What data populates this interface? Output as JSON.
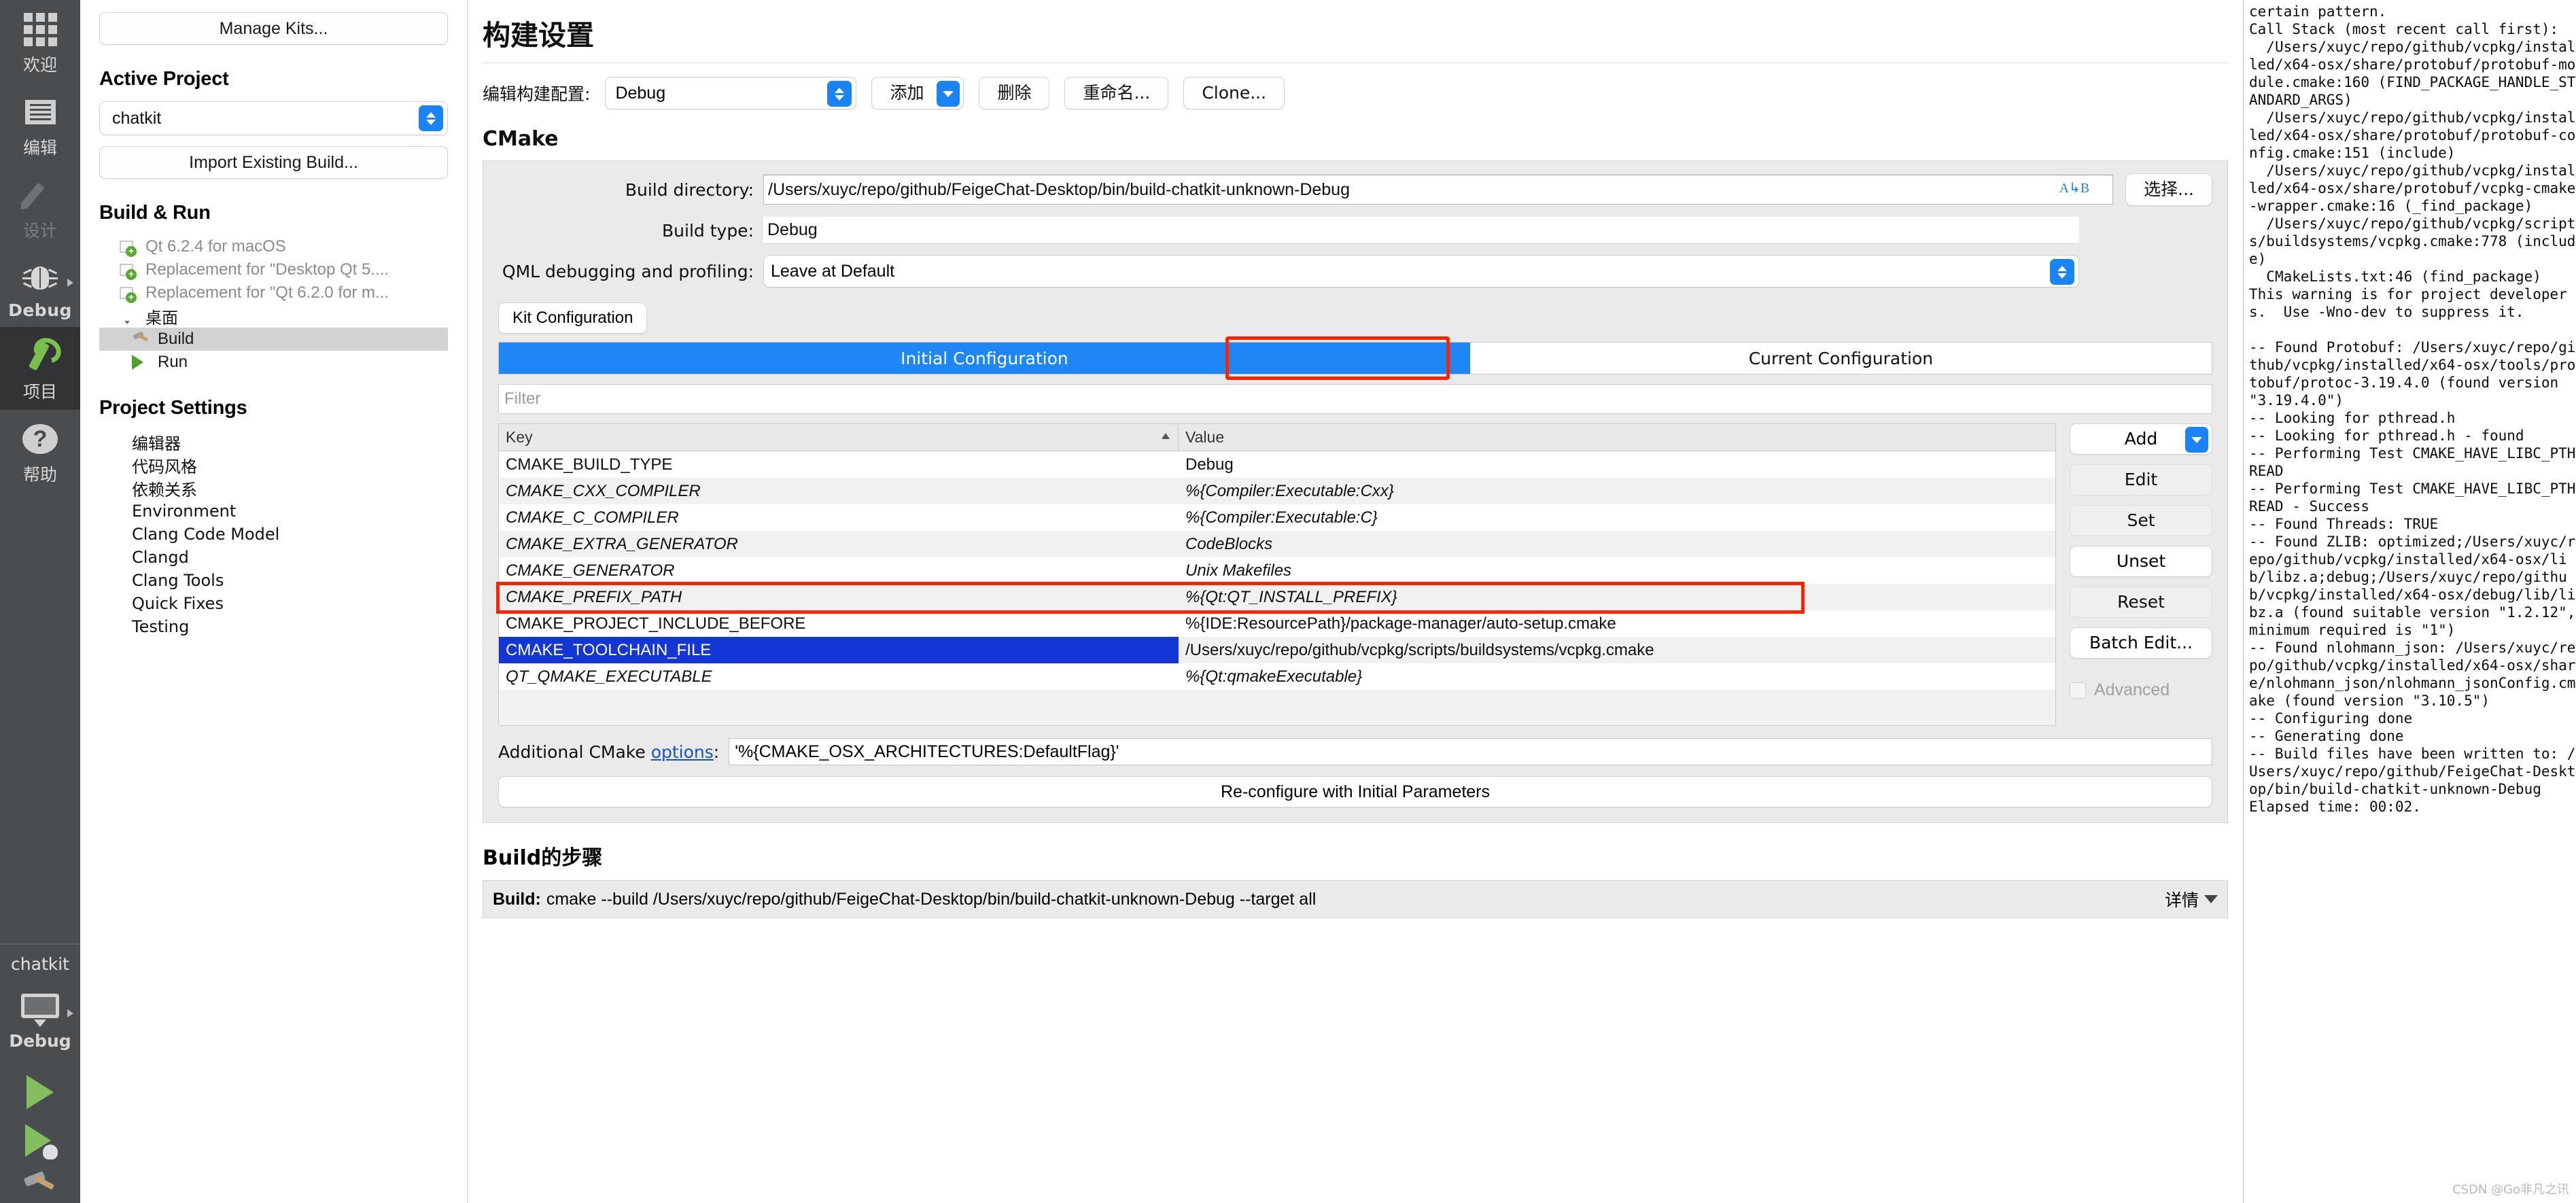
{
  "modebar": {
    "items": [
      {
        "label": "欢迎",
        "icon": "grid-icon",
        "state": "normal"
      },
      {
        "label": "编辑",
        "icon": "document-icon",
        "state": "normal"
      },
      {
        "label": "设计",
        "icon": "pencil-icon",
        "state": "disabled"
      },
      {
        "label": "Debug",
        "icon": "bug-icon",
        "state": "normal"
      },
      {
        "label": "项目",
        "icon": "wrench-icon",
        "state": "active"
      },
      {
        "label": "帮助",
        "icon": "question-icon",
        "state": "normal"
      }
    ],
    "bottom": {
      "kit_name": "chatkit",
      "target_label": "Debug",
      "run_icon": "run-play-icon",
      "debug_icon": "run-debug-icon",
      "build_icon": "build-hammer-icon"
    }
  },
  "projects_panel": {
    "manage_kits": "Manage Kits...",
    "active_project_title": "Active Project",
    "active_project_value": "chatkit",
    "import_existing_build": "Import Existing Build...",
    "build_run_title": "Build & Run",
    "kits": [
      {
        "label": "Qt 6.2.4 for macOS",
        "icon": "kit-icon",
        "dimmed": true
      },
      {
        "label": "Replacement for \"Desktop Qt 5....",
        "icon": "kit-icon",
        "dimmed": true
      },
      {
        "label": "Replacement for \"Qt 6.2.0 for m...",
        "icon": "kit-icon",
        "dimmed": true
      }
    ],
    "active_kit": {
      "label": "桌面",
      "icon": "monitor-icon"
    },
    "build_node": {
      "label": "Build",
      "icon": "hammer-icon",
      "selected": true
    },
    "run_node": {
      "label": "Run",
      "icon": "play-icon",
      "selected": false
    },
    "project_settings_title": "Project Settings",
    "project_settings": [
      "编辑器",
      "代码风格",
      "依赖关系",
      "Environment",
      "Clang Code Model",
      "Clangd",
      "Clang Tools",
      "Quick Fixes",
      "Testing"
    ]
  },
  "main": {
    "page_title": "构建设置",
    "edit_build_config_label": "编辑构建配置:",
    "build_config_value": "Debug",
    "buttons": {
      "add": "添加",
      "remove": "删除",
      "rename": "重命名...",
      "clone": "Clone..."
    },
    "cmake_section_title": "CMake",
    "build_directory_label": "Build directory:",
    "build_directory_value": "/Users/xuyc/repo/github/FeigeChat-Desktop/bin/build-chatkit-unknown-Debug",
    "choose_button": "选择...",
    "build_type_label": "Build type:",
    "build_type_value": "Debug",
    "qml_debug_label": "QML debugging and profiling:",
    "qml_debug_value": "Leave at Default",
    "kit_configuration_button": "Kit Configuration",
    "tabs": [
      {
        "label": "Initial Configuration",
        "active": true,
        "highlighted": true
      },
      {
        "label": "Current Configuration",
        "active": false,
        "highlighted": false
      }
    ],
    "filter_placeholder": "Filter",
    "table": {
      "headers": {
        "key": "Key",
        "value": "Value"
      },
      "rows": [
        {
          "key": "CMAKE_BUILD_TYPE",
          "value": "Debug",
          "italic": false,
          "selected": false
        },
        {
          "key": "CMAKE_CXX_COMPILER",
          "value": "%{Compiler:Executable:Cxx}",
          "italic": true,
          "selected": false
        },
        {
          "key": "CMAKE_C_COMPILER",
          "value": "%{Compiler:Executable:C}",
          "italic": true,
          "selected": false
        },
        {
          "key": "CMAKE_EXTRA_GENERATOR",
          "value": "CodeBlocks",
          "italic": true,
          "selected": false
        },
        {
          "key": "CMAKE_GENERATOR",
          "value": "Unix Makefiles",
          "italic": true,
          "selected": false
        },
        {
          "key": "CMAKE_PREFIX_PATH",
          "value": "%{Qt:QT_INSTALL_PREFIX}",
          "italic": true,
          "selected": false
        },
        {
          "key": "CMAKE_PROJECT_INCLUDE_BEFORE",
          "value": "%{IDE:ResourcePath}/package-manager/auto-setup.cmake",
          "italic": false,
          "selected": false
        },
        {
          "key": "CMAKE_TOOLCHAIN_FILE",
          "value": "/Users/xuyc/repo/github/vcpkg/scripts/buildsystems/vcpkg.cmake",
          "italic": false,
          "selected": true
        },
        {
          "key": "QT_QMAKE_EXECUTABLE",
          "value": "%{Qt:qmakeExecutable}",
          "italic": true,
          "selected": false
        }
      ]
    },
    "side_buttons": {
      "add": "Add",
      "edit": "Edit",
      "set": "Set",
      "unset": "Unset",
      "reset": "Reset",
      "batch_edit": "Batch Edit...",
      "advanced": "Advanced"
    },
    "additional_options_prefix": "Additional CMake ",
    "additional_options_link": "options",
    "additional_options_suffix": ":",
    "additional_options_value": "'%{CMAKE_OSX_ARCHITECTURES:DefaultFlag}'",
    "reconfigure_button": "Re-configure with Initial Parameters",
    "build_steps_title": "Build的步骤",
    "build_step": {
      "prefix": "Build:",
      "command": "cmake --build /Users/xuyc/repo/github/FeigeChat-Desktop/bin/build-chatkit-unknown-Debug --target all",
      "detail_label": "详情"
    }
  },
  "console": {
    "text": "certain pattern.\nCall Stack (most recent call first):\n  /Users/xuyc/repo/github/vcpkg/installed/x64-osx/share/protobuf/protobuf-module.cmake:160 (FIND_PACKAGE_HANDLE_STANDARD_ARGS)\n  /Users/xuyc/repo/github/vcpkg/installed/x64-osx/share/protobuf/protobuf-config.cmake:151 (include)\n  /Users/xuyc/repo/github/vcpkg/installed/x64-osx/share/protobuf/vcpkg-cmake-wrapper.cmake:16 (_find_package)\n  /Users/xuyc/repo/github/vcpkg/scripts/buildsystems/vcpkg.cmake:778 (include)\n  CMakeLists.txt:46 (find_package)\nThis warning is for project developers.  Use -Wno-dev to suppress it.\n\n-- Found Protobuf: /Users/xuyc/repo/github/vcpkg/installed/x64-osx/tools/protobuf/protoc-3.19.4.0 (found version \"3.19.4.0\")\n-- Looking for pthread.h\n-- Looking for pthread.h - found\n-- Performing Test CMAKE_HAVE_LIBC_PTHREAD\n-- Performing Test CMAKE_HAVE_LIBC_PTHREAD - Success\n-- Found Threads: TRUE\n-- Found ZLIB: optimized;/Users/xuyc/repo/github/vcpkg/installed/x64-osx/lib/libz.a;debug;/Users/xuyc/repo/github/vcpkg/installed/x64-osx/debug/lib/libz.a (found suitable version \"1.2.12\", minimum required is \"1\")\n-- Found nlohmann_json: /Users/xuyc/repo/github/vcpkg/installed/x64-osx/share/nlohmann_json/nlohmann_jsonConfig.cmake (found version \"3.10.5\")\n-- Configuring done\n-- Generating done\n-- Build files have been written to: /Users/xuyc/repo/github/FeigeChat-Desktop/bin/build-chatkit-unknown-Debug\nElapsed time: 00:02.",
    "watermark": "CSDN @Go非凡之讯"
  }
}
